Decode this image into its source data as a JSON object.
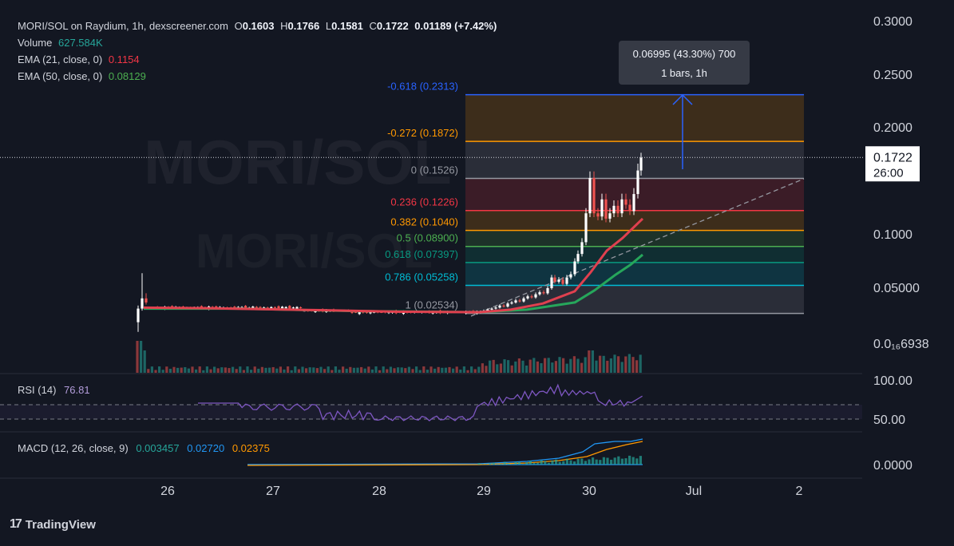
{
  "header": {
    "symbol": "MORI/SOL on Raydium, 1h, dexscreener.com",
    "open_label": "O",
    "open": "0.1603",
    "high_label": "H",
    "high": "0.1766",
    "low_label": "L",
    "low": "0.1581",
    "close_label": "C",
    "close": "0.1722",
    "change": "0.01189 (+7.42%)",
    "volume_label": "Volume",
    "volume": "627.584K",
    "ema21_label": "EMA (21, close, 0)",
    "ema21_value": "0.1154",
    "ema50_label": "EMA (50, close, 0)",
    "ema50_value": "0.08129"
  },
  "watermark": {
    "text": "MORI/SOL"
  },
  "tooltip": {
    "line1": "0.06995 (43.30%) 700",
    "line2": "1 bars, 1h"
  },
  "price_tag": {
    "price": "0.1722",
    "countdown": "26:00"
  },
  "rsi": {
    "label": "RSI (14)",
    "value": "76.81",
    "ticks": [
      "100.00",
      "50.00"
    ]
  },
  "macd": {
    "label": "MACD (12, 26, close, 9)",
    "hist": "0.003457",
    "macd": "0.02720",
    "signal": "0.02375",
    "ticks": [
      "0.0000"
    ]
  },
  "branding": {
    "text": "TradingView"
  },
  "colors": {
    "bg": "#131722",
    "up": "#ffffff",
    "down": "#ef5350",
    "ema21": "#e0404f",
    "ema50": "#26a65b",
    "rsi": "#7e57c2",
    "macd": "#2196f3",
    "signal": "#ff9800",
    "hist": "#26a69a"
  },
  "chart_data": {
    "type": "candlestick",
    "price_axis_ticks": [
      {
        "label": "0.3000",
        "value": 0.3
      },
      {
        "label": "0.2500",
        "value": 0.25
      },
      {
        "label": "0.2000",
        "value": 0.2
      },
      {
        "label": "0.1000",
        "value": 0.1
      },
      {
        "label": "0.05000",
        "value": 0.05
      },
      {
        "label": "0.0₁₆6938",
        "value": 0.0
      }
    ],
    "time_axis_ticks": [
      "26",
      "27",
      "28",
      "29",
      "30",
      "Jul",
      "2"
    ],
    "fib_levels": [
      {
        "ratio": "-0.618",
        "price": "0.2313",
        "color": "#2962ff"
      },
      {
        "ratio": "-0.272",
        "price": "0.1872",
        "color": "#ff9800"
      },
      {
        "ratio": "0",
        "price": "0.1526",
        "color": "#9598a1"
      },
      {
        "ratio": "0.236",
        "price": "0.1226",
        "color": "#f23645"
      },
      {
        "ratio": "0.382",
        "price": "0.1040",
        "color": "#ff9800"
      },
      {
        "ratio": "0.5",
        "price": "0.08900",
        "color": "#4caf50"
      },
      {
        "ratio": "0.618",
        "price": "0.07397",
        "color": "#089981"
      },
      {
        "ratio": "0.786",
        "price": "0.05258",
        "color": "#00bcd4"
      },
      {
        "ratio": "1",
        "price": "0.02534",
        "color": "#9598a1"
      }
    ],
    "last_price": 0.1722
  }
}
